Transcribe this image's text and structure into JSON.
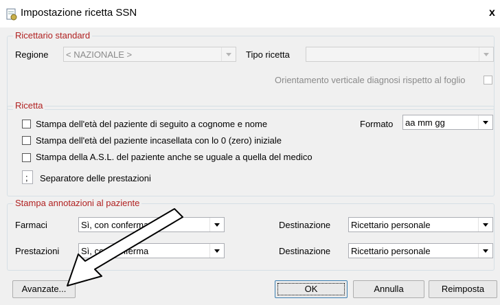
{
  "window": {
    "title": "Impostazione ricetta SSN",
    "close_label": "x"
  },
  "ricettario": {
    "legend": "Ricettario standard",
    "regione_label": "Regione",
    "regione_value": "< NAZIONALE >",
    "tipo_label": "Tipo ricetta",
    "tipo_value": "",
    "orientamento_label": "Orientamento verticale diagnosi rispetto al foglio"
  },
  "ricetta": {
    "legend": "Ricetta",
    "opt1": "Stampa dell'età del paziente di seguito a cognome e nome",
    "opt2": "Stampa dell'età del paziente incasellata con lo 0 (zero) iniziale",
    "opt3": "Stampa della A.S.L. del paziente anche se uguale a quella del medico",
    "formato_label": "Formato",
    "formato_value": "aa mm gg",
    "separatore_value": ";",
    "separatore_label": "Separatore delle prestazioni"
  },
  "annotazioni": {
    "legend": "Stampa annotazioni al paziente",
    "farmaci_label": "Farmaci",
    "farmaci_value": "Sì, con conferma",
    "prestazioni_label": "Prestazioni",
    "prestazioni_value": "Sì, con conferma",
    "dest_label": "Destinazione",
    "dest1_value": "Ricettario personale",
    "dest2_value": "Ricettario personale"
  },
  "buttons": {
    "avanzate": "Avanzate...",
    "ok": "OK",
    "annulla": "Annulla",
    "reimposta": "Reimposta"
  }
}
